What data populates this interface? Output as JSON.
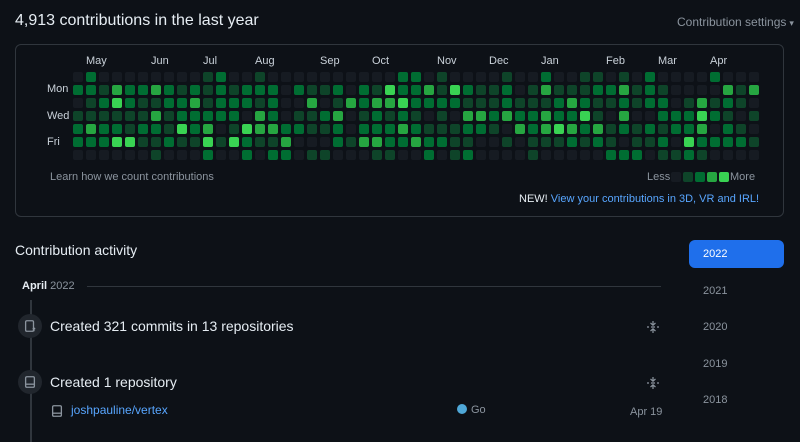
{
  "header": {
    "title": "4,913 contributions in the last year",
    "settings_label": "Contribution settings",
    "settings_caret": "▾"
  },
  "calendar": {
    "months": [
      "May",
      "Jun",
      "Jul",
      "Aug",
      "Sep",
      "Oct",
      "Nov",
      "Dec",
      "Jan",
      "Feb",
      "Mar",
      "Apr"
    ],
    "days": [
      "Mon",
      "Wed",
      "Fri"
    ],
    "learn_label": "Learn how we count contributions",
    "legend_less": "Less",
    "legend_more": "More",
    "colors": [
      "#161b22",
      "#0e4429",
      "#006d32",
      "#26a641",
      "#39d353"
    ]
  },
  "promo": {
    "new_label": "NEW!",
    "link_label": "View your contributions in 3D, VR and IRL!"
  },
  "activity": {
    "title": "Contribution activity",
    "month": "April",
    "year": "2022",
    "events": [
      {
        "title": "Created 321 commits in 13 repositories"
      },
      {
        "title": "Created 1 repository"
      }
    ],
    "repo": {
      "name": "joshpauline/vertex",
      "language": "Go",
      "language_color": "#4fa8d8",
      "date": "Apr 19"
    }
  },
  "years": [
    "2022",
    "2021",
    "2020",
    "2019",
    "2018"
  ]
}
